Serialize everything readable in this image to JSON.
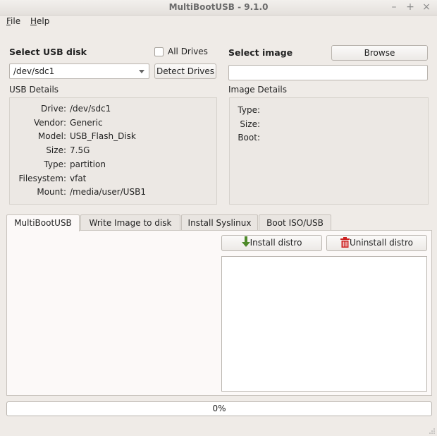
{
  "window": {
    "title": "MultiBootUSB - 9.1.0",
    "minimize_glyph": "–",
    "maximize_glyph": "+",
    "close_glyph": "×"
  },
  "menu": [
    {
      "label": "File",
      "mnemonic": "F",
      "rest": "ile"
    },
    {
      "label": "Help",
      "mnemonic": "H",
      "rest": "elp"
    }
  ],
  "usb": {
    "heading": "Select USB disk",
    "all_drives_label": "All Drives",
    "all_drives_checked": false,
    "selected_disk": "/dev/sdc1",
    "detect_button": "Detect Drives",
    "details_heading": "USB Details",
    "details": [
      {
        "key": "Drive:",
        "value": "/dev/sdc1"
      },
      {
        "key": "Vendor:",
        "value": "Generic"
      },
      {
        "key": "Model:",
        "value": "USB_Flash_Disk"
      },
      {
        "key": "Size:",
        "value": "7.5G"
      },
      {
        "key": "Type:",
        "value": "partition"
      },
      {
        "key": "Filesystem:",
        "value": "vfat"
      },
      {
        "key": "Mount:",
        "value": "/media/user/USB1"
      }
    ]
  },
  "image": {
    "heading": "Select image",
    "browse_button": "Browse",
    "path_value": "",
    "details_heading": "Image Details",
    "details": [
      {
        "key": "Type:",
        "value": ""
      },
      {
        "key": "Size:",
        "value": ""
      },
      {
        "key": "Boot:",
        "value": ""
      }
    ]
  },
  "tabs": [
    {
      "label": "MultiBootUSB",
      "active": true
    },
    {
      "label": "Write Image to disk",
      "active": false
    },
    {
      "label": "Install Syslinux",
      "active": false
    },
    {
      "label": "Boot ISO/USB",
      "active": false
    }
  ],
  "actions": {
    "install_button": "Install distro",
    "uninstall_button": "Uninstall distro",
    "install_icon_color": "#4e8a2a",
    "uninstall_icon_color": "#cc1f1f"
  },
  "progress": {
    "value": 0,
    "label": "0%"
  }
}
